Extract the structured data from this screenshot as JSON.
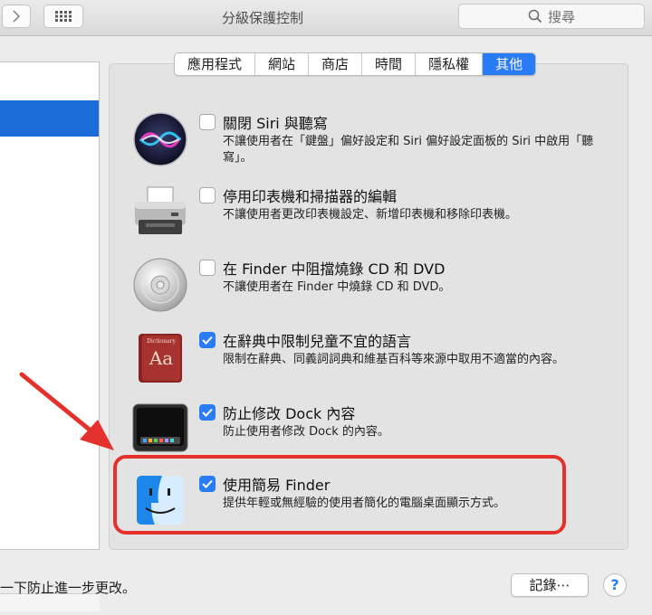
{
  "window": {
    "title": "分級保護控制"
  },
  "search": {
    "placeholder": "搜尋"
  },
  "tabs": [
    {
      "label": "應用程式",
      "active": false
    },
    {
      "label": "網站",
      "active": false
    },
    {
      "label": "商店",
      "active": false
    },
    {
      "label": "時間",
      "active": false
    },
    {
      "label": "隱私權",
      "active": false
    },
    {
      "label": "其他",
      "active": true
    }
  ],
  "options": [
    {
      "icon": "siri-icon",
      "checked": false,
      "title": "關閉 Siri 與聽寫",
      "description": "不讓使用者在「鍵盤」偏好設定和 Siri 偏好設定面板的 Siri 中啟用「聽寫」。"
    },
    {
      "icon": "printer-icon",
      "checked": false,
      "title": "停用印表機和掃描器的編輯",
      "description": "不讓使用者更改印表機設定、新增印表機和移除印表機。"
    },
    {
      "icon": "disc-icon",
      "checked": false,
      "title": "在 Finder 中阻擋燒錄 CD 和 DVD",
      "description": "不讓使用者在 Finder 中燒錄 CD 和 DVD。"
    },
    {
      "icon": "dictionary-icon",
      "checked": true,
      "title": "在辭典中限制兒童不宜的語言",
      "description": "限制在辭典、同義詞詞典和維基百科等來源中取用不適當的內容。"
    },
    {
      "icon": "dock-icon",
      "checked": true,
      "title": "防止修改 Dock 內容",
      "description": "防止使用者修改 Dock 的內容。"
    },
    {
      "icon": "finder-icon",
      "checked": true,
      "title": "使用簡易 Finder",
      "description": "提供年輕或無經驗的使用者簡化的電腦桌面顯示方式。"
    }
  ],
  "icon_labels": {
    "dictionary": "Dictionary",
    "dictionary_glyph": "Aa"
  },
  "footer": {
    "lock_text": "一下防止進一步更改。",
    "logs_label": "記錄⋯",
    "help_label": "?"
  },
  "colors": {
    "accent": "#2a7cf6",
    "selection": "#1b6bd8",
    "annotation": "#e5312b"
  }
}
